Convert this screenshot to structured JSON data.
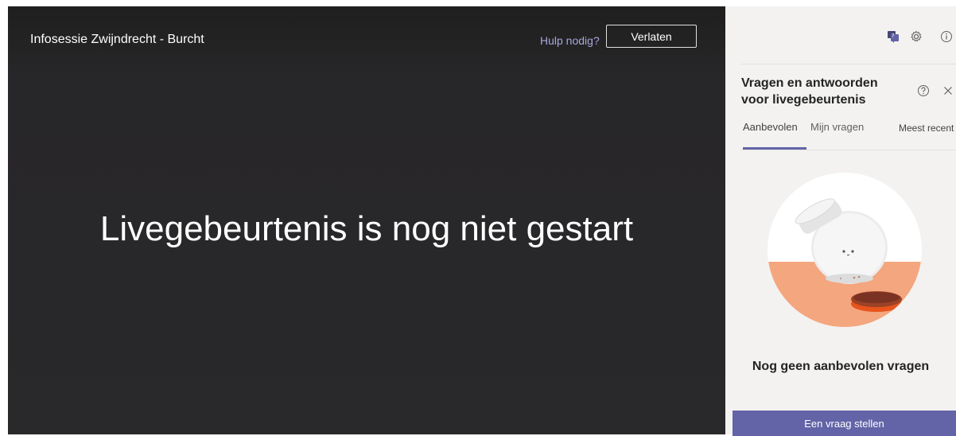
{
  "stage": {
    "event_title": "Infosessie Zwijndrecht - Burcht",
    "help_link": "Hulp nodig?",
    "leave_button": "Verlaten",
    "status_message": "Livegebeurtenis is nog niet gestart"
  },
  "panel": {
    "top_icons": [
      "qna-icon",
      "settings-gear-icon",
      "info-icon"
    ],
    "title": "Vragen en antwoorden voor livegebeurtenis",
    "tabs": [
      {
        "label": "Aanbevolen",
        "active": true
      },
      {
        "label": "Mijn vragen",
        "active": false
      }
    ],
    "sort_label": "Meest recent",
    "empty_message": "Nog geen aanbevolen vragen",
    "ask_button": "Een vraag stellen"
  },
  "colors": {
    "accent": "#6264a7",
    "help_link": "#a6a7dc",
    "stage_bg": "#29282a",
    "panel_bg": "#f3f2f1",
    "illustration_orange": "#f4a67f"
  }
}
